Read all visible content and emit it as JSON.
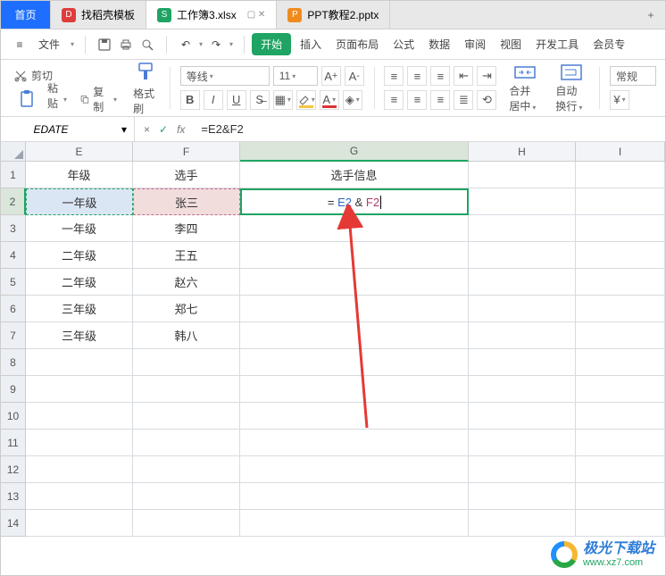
{
  "tabs": {
    "home": "首页",
    "t1": "找稻壳模板",
    "t2": "工作簿3.xlsx",
    "t3": "PPT教程2.pptx",
    "plus": "+"
  },
  "menu": {
    "file": "文件",
    "start": "开始",
    "insert": "插入",
    "page": "页面布局",
    "formula": "公式",
    "data": "数据",
    "review": "审阅",
    "view": "视图",
    "dev": "开发工具",
    "member": "会员专"
  },
  "ribbon": {
    "cut": "剪切",
    "paste": "粘贴",
    "copy": "复制",
    "format_painter": "格式刷",
    "font_name": "等线",
    "font_size": "11",
    "bold": "B",
    "italic": "I",
    "underline": "U",
    "strike": "A",
    "merge_center": "合并居中",
    "wrap": "自动换行",
    "general": "常规"
  },
  "formula_bar": {
    "name": "EDATE",
    "cancel": "×",
    "accept": "✓",
    "fx": "fx",
    "value": "=E2&F2"
  },
  "columns": {
    "E": "E",
    "F": "F",
    "G": "G",
    "H": "H",
    "I": "I"
  },
  "grid": {
    "headers": {
      "E": "年级",
      "F": "选手",
      "G": "选手信息"
    },
    "rows": [
      {
        "n": "1"
      },
      {
        "n": "2",
        "E": "一年级",
        "F": "张三",
        "G_prefix": "= ",
        "G_ref1": "E2",
        "G_amp": " & ",
        "G_ref2": "F2"
      },
      {
        "n": "3",
        "E": "一年级",
        "F": "李四"
      },
      {
        "n": "4",
        "E": "二年级",
        "F": "王五"
      },
      {
        "n": "5",
        "E": "二年级",
        "F": "赵六"
      },
      {
        "n": "6",
        "E": "三年级",
        "F": "郑七"
      },
      {
        "n": "7",
        "E": "三年级",
        "F": "韩八"
      },
      {
        "n": "8"
      },
      {
        "n": "9"
      },
      {
        "n": "10"
      },
      {
        "n": "11"
      },
      {
        "n": "12"
      },
      {
        "n": "13"
      },
      {
        "n": "14"
      }
    ]
  },
  "watermark": {
    "title": "极光下载站",
    "url": "www.xz7.com"
  }
}
